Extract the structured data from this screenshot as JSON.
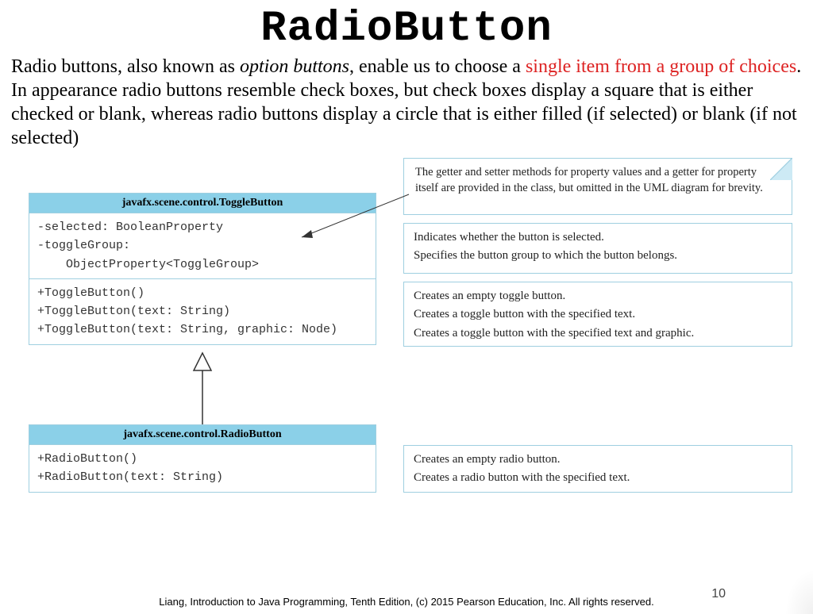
{
  "title": "RadioButton",
  "intro": {
    "pre": "Radio buttons, also known as ",
    "italic": "option buttons",
    "mid": ", enable us to choose a ",
    "red": "single item from a group of choices",
    "post": ". In appearance radio buttons resemble check boxes, but check boxes display a square that is either checked or blank, whereas radio buttons display a circle that is either filled (if selected) or blank (if not selected)"
  },
  "note": "The getter and setter methods for property values and a getter for property itself are provided in the class, but omitted in the UML diagram for brevity.",
  "toggle": {
    "header": "javafx.scene.control.ToggleButton",
    "attrs": [
      "-selected: BooleanProperty",
      "-toggleGroup:",
      "    ObjectProperty<ToggleGroup>"
    ],
    "ops": [
      "+ToggleButton()",
      "+ToggleButton(text: String)",
      "+ToggleButton(text: String, graphic: Node)"
    ]
  },
  "toggleDesc": {
    "attrs": [
      "Indicates whether the button is selected.",
      "Specifies the button group to which the button belongs."
    ],
    "ops": [
      "Creates an empty toggle button.",
      "Creates a toggle button with the specified text.",
      "Creates a toggle button with the specified text and graphic."
    ]
  },
  "radio": {
    "header": "javafx.scene.control.RadioButton",
    "ops": [
      "+RadioButton()",
      "+RadioButton(text: String)"
    ]
  },
  "radioDesc": {
    "ops": [
      "Creates an empty radio button.",
      "Creates a radio button with the specified text."
    ]
  },
  "footer": "Liang, Introduction to Java Programming, Tenth Edition, (c) 2015 Pearson Education, Inc. All rights reserved.",
  "pageNumber": "10"
}
